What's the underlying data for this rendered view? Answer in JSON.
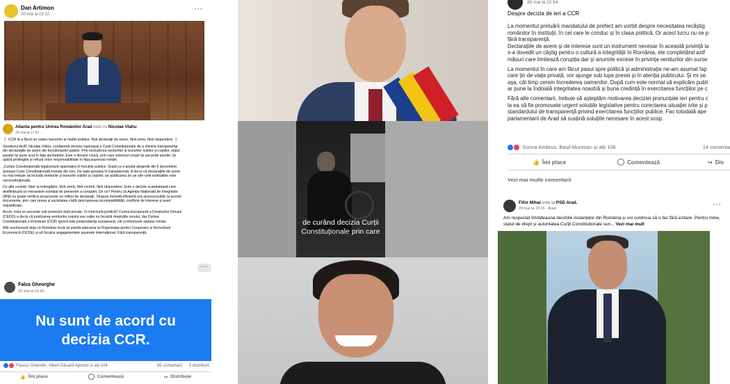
{
  "p1": {
    "author": "Dan Artimon",
    "date": "30 mai la 18:32 ·",
    "more": "···"
  },
  "p2": {
    "author": "Alianta pentru Unirea Românilor Arad",
    "with_text": "este cu",
    "with_name": "Nicolae Vlahu",
    "date": "30 mai la 17:50 ·",
    "paragraphs": [
      "❗ CCR le-a făcut un cadou baronilor și mafiei politice: fără declarații de avere, fără urme, fără răspundere ❗",
      "Senatorul AUR, Nicolae Vlahu, condamnă decizia rușinoasă a Curții Constituționale de a elimina transparența din declarațiile de avere ale funcționarilor publici. Prin excluderea veniturilor și bunurilor soțiilor și copiilor, statul paralel își pune scut în fața anchetelor. Este o decizie cinică, prin care sistemul corupt își ascunde averile, își apără privilegiile și refuză orice responsabilitate în fața poporului român.",
      "„Curtea Constituțională legalizează opacitatea în funcțiile publice. După ce a anulat alegerile din 6 decembrie, aceeași Curte Constituțională lovește din nou. De data aceasta în transparență. A decis că declarațiile de avere nu mai trebuie să includă veniturile și bunurile soțiilor și copiilor, iar publicarea lor pe site-urile instituțiilor este neconstituțională.",
      "Cu alte cuvinte: liber la îmbogățire, fără urmă, fără control, fără răspundere. Este o decizie scandaloasă care desființează un mecanism esențial de prevenire a corupției. De ce? Pentru că Agenția Națională de Integritate (ANI) nu poate verifica anual peste un milion de declarații. Singura metodă eficientă era accesul public la aceste documente, prin care presa și societatea civilă descopereau incompatibilități, conflicte de interese și averi nejustificate.",
      "Acum, totul se ascunde sub pretextul vieții private. O mrniciună juridică!! Curtea Europeană a Drepturilor Omului (CEDO) a decis că publicarea veniturilor soțului sau soției nu încalcă dreptul/le omului, dar Curtea Constituțională a României (CCR) ignoră atât jurisprudența europeană, cât și interesele statului român.",
      "ANI avertizează deja că România riscă să piardă aderarea la Organizația pentru Cooperare și Dezvoltare Economică (OCDE) și să încalce angajamentele asumate internațional. Fără transparență,"
    ]
  },
  "p3": {
    "more": "···",
    "author": "Falca Gheorghe",
    "date": "29 mai la 21:42 ·",
    "banner_line1": "Nu sunt de acord cu",
    "banner_line2": "decizia CCR.",
    "reactions": "Flavius Ghender, Albert Eduard Apostol și alți 104",
    "comments": "65 comentarii",
    "shares": "5 distribuiri",
    "like": "Îmi place",
    "comment": "Comentează",
    "share": "Distribuie"
  },
  "video": {
    "caption_line1": "de curând decizia Curții",
    "caption_line2": "Constituționale prin care"
  },
  "p4": {
    "date": "30 mai la 10:54 ·",
    "heading": "Despre decizia de ieri a CCR",
    "lines": [
      "La momentul preluării mandatului de prefect am vorbit despre necesitatea recâștig",
      "românilor în instituții, în cei care le conduc și în clasa politică. Or acest lucru nu se p",
      "fără transparență.",
      "Declarațiile de avere și de interese sunt un instrument necesar în această privință ia",
      "s-a dovedit un câștig pentru o cultură a integrității în România, ele completând astf",
      "măsuri care limitează corupția dar și anumite excese în privința veniturilor din surse",
      "",
      "La momentul în care am făcut pasul spre politică și administrație ne-am asumat fap",
      "care țin de viața privată, vor ajunge sub lupa presei și în atenția publicului. Și mi se",
      "așa, cât timp cerem încrederea oamenilor. După cum este normal să explicăm publi",
      "ar pune la îndoială integritatea noastră și buna credință în exercitarea funcțiilor pe c",
      "",
      "Fără alte comentarii, trebuie să așteptăm motivarea deciziei pronunțate ieri pentru c",
      "la ea să fie promovate urgent soluțiile legislative pentru corectarea situației ivite și p",
      "standardului de transparență privind exercitarea funcțiilor publice. Fac totodată ape",
      "parlamentarii de Arad să susțină soluțiile necesare în acest scop."
    ],
    "reactions": "Sorina Ambrus, Basil Muresan și alți 106",
    "comments": "14 comenta",
    "like": "Îmi place",
    "comment": "Comentează",
    "share": "Dis",
    "more_comments": "Vezi mai multe comentarii"
  },
  "p5": {
    "author": "Fifor Mihai",
    "with_text": "este la",
    "place": "PSD Arad.",
    "date": "29 mai la 19:15 · Arad ·",
    "more": "···",
    "text": "Am respectat întotdeauna deciziile instanțelor din România și voi continua să o fac fără ezitare. Pentru mine, statul de drept și autoritatea Curții Constituționale sun...",
    "see_more": "Vezi mai mult"
  },
  "colors": {
    "facebook_blue": "#1877f2",
    "banner_blue": "#1b7bf0",
    "muted": "#65676b"
  }
}
